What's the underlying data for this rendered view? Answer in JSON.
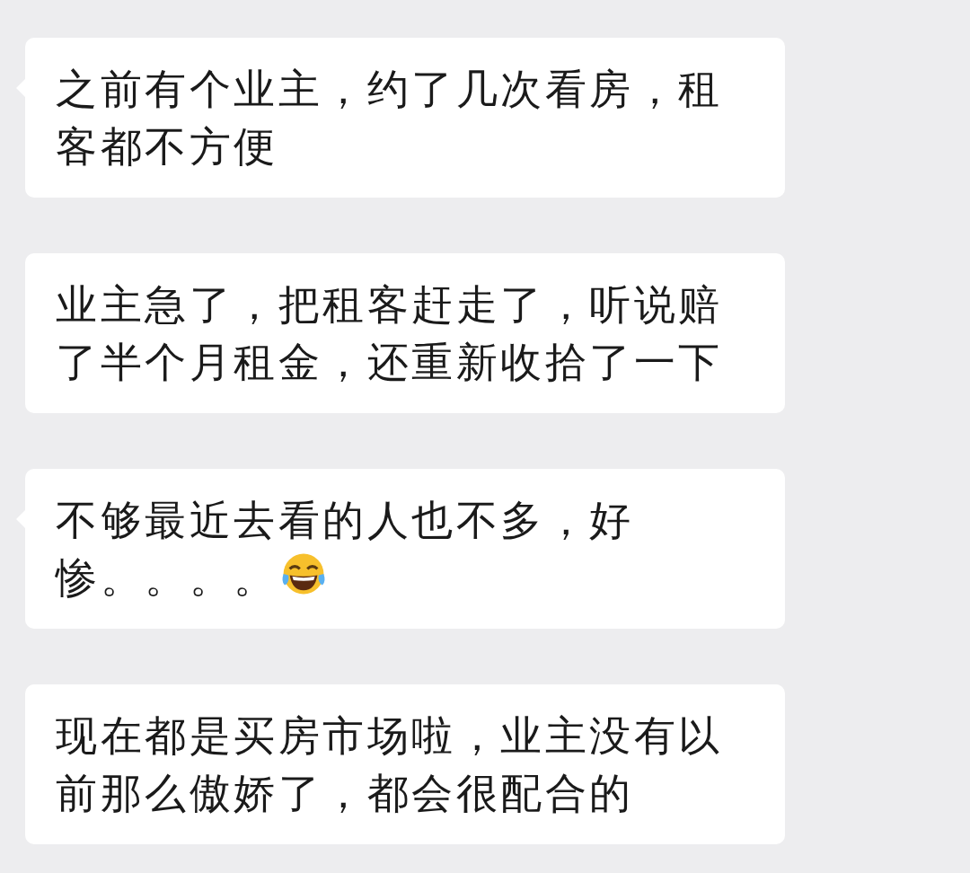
{
  "messages": [
    {
      "text": "之前有个业主，约了几次看房，租客都不方便",
      "tail": true,
      "emoji": false
    },
    {
      "text": "业主急了，把租客赶走了，听说赔了半个月租金，还重新收拾了一下",
      "tail": false,
      "emoji": false
    },
    {
      "text": "不够最近去看的人也不多，好惨。。。。",
      "tail": true,
      "emoji": true
    },
    {
      "text": "现在都是买房市场啦，业主没有以前那么傲娇了，都会很配合的",
      "tail": false,
      "emoji": false
    }
  ]
}
